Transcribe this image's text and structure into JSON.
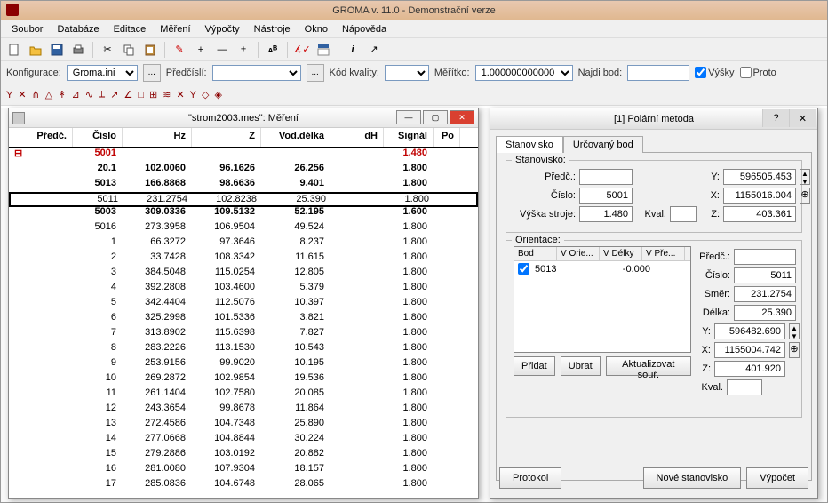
{
  "app": {
    "title": "GROMA v. 11.0 - Demonstrační verze"
  },
  "menu": [
    "Soubor",
    "Databáze",
    "Editace",
    "Měření",
    "Výpočty",
    "Nástroje",
    "Okno",
    "Nápověda"
  ],
  "configbar": {
    "konfigurace_label": "Konfigurace:",
    "konfigurace_value": "Groma.ini",
    "ellipsis": "...",
    "predcisli_label": "Předčíslí:",
    "predcisli_value": "",
    "kod_label": "Kód kvality:",
    "kod_value": "",
    "meritko_label": "Měřítko:",
    "meritko_value": "1.000000000000",
    "najdibod_label": "Najdi bod:",
    "najdibod_value": "",
    "vysky_label": "Výšky",
    "proto_label": "Proto"
  },
  "leftwin": {
    "title": "\"strom2003.mes\": Měření",
    "headers": [
      "Předč.",
      "Číslo",
      "Hz",
      "Z",
      "Vod.délka",
      "dH",
      "Signál",
      "Po"
    ],
    "rows": [
      {
        "exp": "⊟",
        "cislo": "5001",
        "hz": "",
        "z": "",
        "vod": "",
        "dh": "",
        "sig": "1.480",
        "style": "red"
      },
      {
        "cislo": "20.1",
        "hz": "102.0060",
        "z": "96.1626",
        "vod": "26.256",
        "dh": "",
        "sig": "1.800",
        "style": "bold"
      },
      {
        "cislo": "5013",
        "hz": "166.8868",
        "z": "98.6636",
        "vod": "9.401",
        "dh": "",
        "sig": "1.800",
        "style": "bold"
      },
      {
        "cislo": "5011",
        "hz": "231.2754",
        "z": "102.8238",
        "vod": "25.390",
        "dh": "",
        "sig": "1.800",
        "style": "boxed"
      },
      {
        "cislo": "5003",
        "hz": "309.0336",
        "z": "109.5132",
        "vod": "52.195",
        "dh": "",
        "sig": "1.600",
        "style": "bold"
      },
      {
        "cislo": "5016",
        "hz": "273.3958",
        "z": "106.9504",
        "vod": "49.524",
        "dh": "",
        "sig": "1.800"
      },
      {
        "cislo": "1",
        "hz": "66.3272",
        "z": "97.3646",
        "vod": "8.237",
        "dh": "",
        "sig": "1.800"
      },
      {
        "cislo": "2",
        "hz": "33.7428",
        "z": "108.3342",
        "vod": "11.615",
        "dh": "",
        "sig": "1.800"
      },
      {
        "cislo": "3",
        "hz": "384.5048",
        "z": "115.0254",
        "vod": "12.805",
        "dh": "",
        "sig": "1.800"
      },
      {
        "cislo": "4",
        "hz": "392.2808",
        "z": "103.4600",
        "vod": "5.379",
        "dh": "",
        "sig": "1.800"
      },
      {
        "cislo": "5",
        "hz": "342.4404",
        "z": "112.5076",
        "vod": "10.397",
        "dh": "",
        "sig": "1.800"
      },
      {
        "cislo": "6",
        "hz": "325.2998",
        "z": "101.5336",
        "vod": "3.821",
        "dh": "",
        "sig": "1.800"
      },
      {
        "cislo": "7",
        "hz": "313.8902",
        "z": "115.6398",
        "vod": "7.827",
        "dh": "",
        "sig": "1.800"
      },
      {
        "cislo": "8",
        "hz": "283.2226",
        "z": "113.1530",
        "vod": "10.543",
        "dh": "",
        "sig": "1.800"
      },
      {
        "cislo": "9",
        "hz": "253.9156",
        "z": "99.9020",
        "vod": "10.195",
        "dh": "",
        "sig": "1.800"
      },
      {
        "cislo": "10",
        "hz": "269.2872",
        "z": "102.9854",
        "vod": "19.536",
        "dh": "",
        "sig": "1.800"
      },
      {
        "cislo": "11",
        "hz": "261.1404",
        "z": "102.7580",
        "vod": "20.085",
        "dh": "",
        "sig": "1.800"
      },
      {
        "cislo": "12",
        "hz": "243.3654",
        "z": "99.8678",
        "vod": "11.864",
        "dh": "",
        "sig": "1.800"
      },
      {
        "cislo": "13",
        "hz": "272.4586",
        "z": "104.7348",
        "vod": "25.890",
        "dh": "",
        "sig": "1.800"
      },
      {
        "cislo": "14",
        "hz": "277.0668",
        "z": "104.8844",
        "vod": "30.224",
        "dh": "",
        "sig": "1.800"
      },
      {
        "cislo": "15",
        "hz": "279.2886",
        "z": "103.0192",
        "vod": "20.882",
        "dh": "",
        "sig": "1.800"
      },
      {
        "cislo": "16",
        "hz": "281.0080",
        "z": "107.9304",
        "vod": "18.157",
        "dh": "",
        "sig": "1.800"
      },
      {
        "cislo": "17",
        "hz": "285.0836",
        "z": "104.6748",
        "vod": "28.065",
        "dh": "",
        "sig": "1.800"
      }
    ]
  },
  "rightwin": {
    "title": "[1] Polární metoda",
    "help": "?",
    "tabs": [
      "Stanovisko",
      "Určovaný bod"
    ],
    "stanovisko": {
      "group_label": "Stanovisko:",
      "predc_label": "Předč.:",
      "predc_value": "",
      "cislo_label": "Číslo:",
      "cislo_value": "5001",
      "vyska_label": "Výška stroje:",
      "vyska_value": "1.480",
      "kval_label": "Kval.",
      "kval_value": "",
      "y_label": "Y:",
      "y_value": "596505.453",
      "x_label": "X:",
      "x_value": "1155016.004",
      "z_label": "Z:",
      "z_value": "403.361"
    },
    "orientace": {
      "group_label": "Orientace:",
      "headers": [
        "Bod",
        "V Orie...",
        "V Délky",
        "V Pře..."
      ],
      "row_bod": "5013",
      "row_delky": "-0.000",
      "predc_label": "Předč.:",
      "predc_value": "",
      "cislo_label": "Číslo:",
      "cislo_value": "5011",
      "smer_label": "Směr:",
      "smer_value": "231.2754",
      "delka_label": "Délka:",
      "delka_value": "25.390",
      "y_label": "Y:",
      "y_value": "596482.690",
      "x_label": "X:",
      "x_value": "1155004.742",
      "z_label": "Z:",
      "z_value": "401.920",
      "kval_label": "Kval.",
      "kval_value": ""
    },
    "btns": {
      "pridat": "Přidat",
      "ubrat": "Ubrat",
      "aktual": "Aktualizovat souř."
    },
    "bottom": {
      "protokol": "Protokol",
      "nove": "Nové stanovisko",
      "vypocet": "Výpočet"
    }
  }
}
